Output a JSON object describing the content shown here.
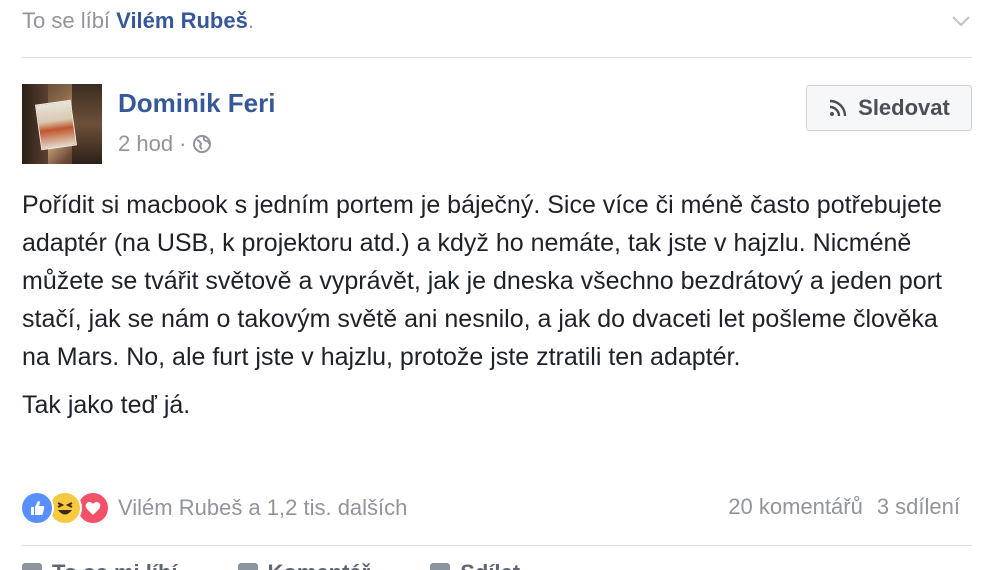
{
  "likes_bar": {
    "prefix": "To se líbí",
    "name": "Vilém Rubeš",
    "suffix": "."
  },
  "post": {
    "author": "Dominik Feri",
    "time": "2 hod",
    "separator": "·",
    "follow_label": "Sledovat",
    "paragraphs": [
      "Pořídit si macbook s jedním portem je báječný. Sice více či méně často potřebujete adaptér (na USB, k projektoru atd.) a když ho nemáte, tak jste v hajzlu. Nicméně můžete se tvářit světově a vyprávět, jak je dneska všechno bezdrátový a jeden port stačí, jak se nám o takovým světě ani nesnilo, a jak do dvaceti let pošleme člověka na Mars. No, ale furt jste v hajzlu, protože jste ztratili ten adaptér.",
      "Tak jako teď já."
    ],
    "reactors": "Vilém Rubeš a 1,2 tis. dalších",
    "comments": "20 komentářů",
    "shares": "3 sdílení",
    "actions": [
      "To se mi líbí",
      "Komentář",
      "Sdílet"
    ]
  },
  "colors": {
    "link": "#365899",
    "muted": "#90949c",
    "like": "#5890ff",
    "haha": "#f7c941",
    "love": "#f25268"
  }
}
